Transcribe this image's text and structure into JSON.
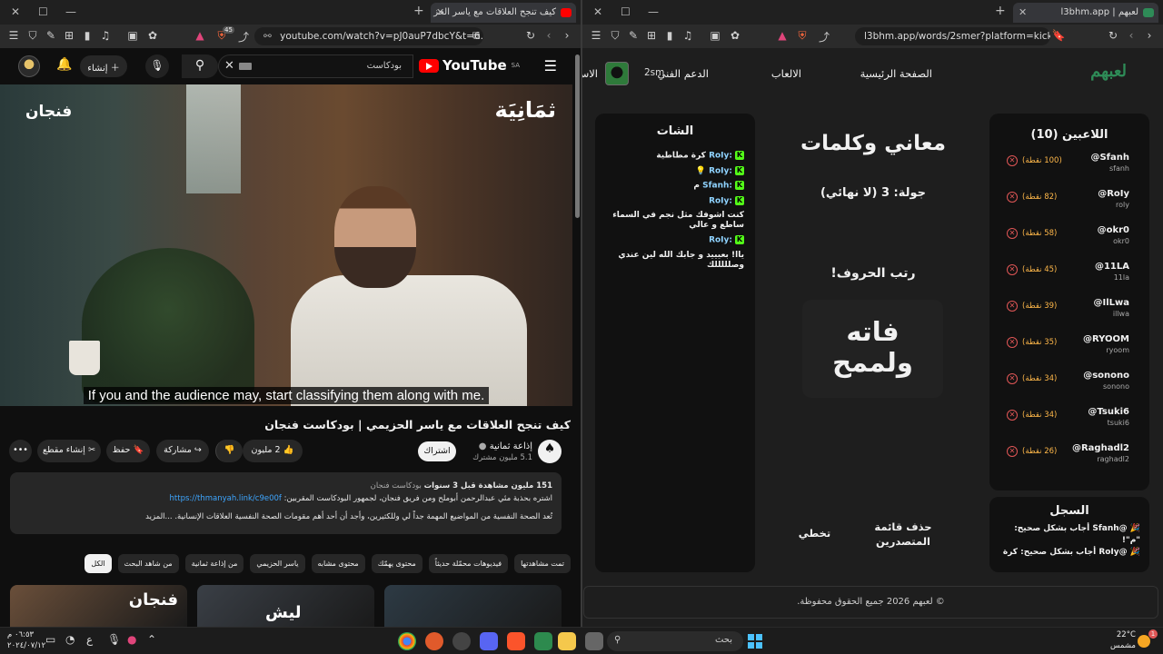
{
  "left_browser": {
    "tab_title": "كيف تنجح العلاقات مع ياسر الحز",
    "url": "youtube.com/watch?v=pJ0auP7dbcY&t=6...",
    "extension_badge": "45"
  },
  "youtube": {
    "logo_text": "YouTube",
    "logo_region": "SA",
    "search_value": "بودكاست",
    "create_label": "إنشاء",
    "video": {
      "brand_left": "فنجان",
      "brand_right": "ثمَانِيَة",
      "caption": "If you and the audience may, start classifying them along with me."
    },
    "title": "كيف تنجح العلاقات مع ياسر الحزيمي | بودكاست فنجان",
    "channel_name": "إذاعة ثمانية",
    "channel_subs": "5.1 مليون مشترك",
    "subscribe_label": "اشتراك",
    "likes": "2 مليون",
    "share_label": "مشاركة",
    "save_label": "حفظ",
    "clip_label": "إنشاء مقطع",
    "description": {
      "meta": "151 مليون مشاهدة  قبل 3 سنوات",
      "tag": "بودكاست فنجان",
      "line1": "اشتره بحذبة مئي عبدالرحمن أبوملح ومن فريق فنجان، لجمهور البودكاست المقربين:",
      "link": "https://thmanyah.link/c9e00f",
      "line2": "تُعد الصحة النفسية من المواضيع المهمة جداً لي وللكثيرين، وأجد أن أحد أهم مقومات الصحة النفسية العلاقات الإنسانية. ...المزيد"
    },
    "chips": [
      "الكل",
      "من شاهد البحث",
      "من إذاعة ثمانية",
      "ياسر الحزيمي",
      "محتوى مشابه",
      "محتوى يهمّك",
      "فيديوهات محمّلة حديثاً",
      "تمت مشاهدتها"
    ],
    "thumbs": [
      {
        "label": "فنجان",
        "color": "#6a4f3a"
      },
      {
        "label": "ليش",
        "color": "#3a3f46"
      },
      {
        "label": "",
        "color": "#2d3a44"
      }
    ]
  },
  "right_browser": {
    "tab_title": "لعبهم | l3bhm.app",
    "url": "l3bhm.app/words/2smer?platform=kick"
  },
  "app": {
    "logo": "لعبهم",
    "nav": {
      "home": "الصفحة الرئيسية",
      "games": "الالعاب",
      "support": "الدعم الفني",
      "extra": "الاس",
      "username": "2sm"
    },
    "chat": {
      "title": "الشات",
      "messages": [
        {
          "user": "RoIy:",
          "text": "كرة مطاطية"
        },
        {
          "user": "RoIy:",
          "text": "💡"
        },
        {
          "user": "Sfanh:",
          "text": "م"
        },
        {
          "user": "RoIy:",
          "text": ""
        },
        {
          "user": "",
          "text": "كنت اشوفك مثل نجم في السماء ساطع و عالي"
        },
        {
          "user": "RoIy:",
          "text": ""
        },
        {
          "user": "",
          "text": "ياا! بعيييد و جابك الله لين عندي وصلللللك"
        }
      ]
    },
    "game": {
      "title": "معاني وكلمات",
      "round": "جولة: 3 (لا نهائي)",
      "instruction": "رتب الحروف!",
      "word_line1": "فاته",
      "word_line2": "ولممح",
      "clear_label": "حذف قائمة المتصدرين",
      "skip_label": "تخطي"
    },
    "players": {
      "title": "اللاعبين (10)",
      "list": [
        {
          "name": "@Sfanh",
          "handle": "sfanh",
          "points": "(100 نقطة)"
        },
        {
          "name": "@RoIy",
          "handle": "roly",
          "points": "(82 نقطة)"
        },
        {
          "name": "@okr0",
          "handle": "okr0",
          "points": "(58 نقطة)"
        },
        {
          "name": "@11LA",
          "handle": "11la",
          "points": "(45 نقطة)"
        },
        {
          "name": "@IlLwa",
          "handle": "illwa",
          "points": "(39 نقطة)"
        },
        {
          "name": "@RYOOM",
          "handle": "ryoom",
          "points": "(35 نقطة)"
        },
        {
          "name": "@sonono",
          "handle": "sonono",
          "points": "(34 نقطة)"
        },
        {
          "name": "@Tsuki6",
          "handle": "tsuki6",
          "points": "(34 نقطة)"
        },
        {
          "name": "@Raghadl2",
          "handle": "raghadl2",
          "points": "(26 نقطة)"
        }
      ]
    },
    "log": {
      "title": "السجل",
      "entries": [
        "🎉 @Sfanh أجاب بشكل صحيح: \"م\"!",
        "🎉 @RoIy أجاب بشكل صحيح: كرة"
      ]
    },
    "footer": "© لعبهم 2026 جميع الحقوق محفوظة."
  },
  "taskbar": {
    "search_placeholder": "بحث",
    "time": "٠٦:٥٣ م",
    "date": "٢٠٢٤/٠٧/١٢",
    "lang": "ع",
    "temperature": "22°C",
    "weather": "مشمس",
    "notification_count": "1"
  }
}
